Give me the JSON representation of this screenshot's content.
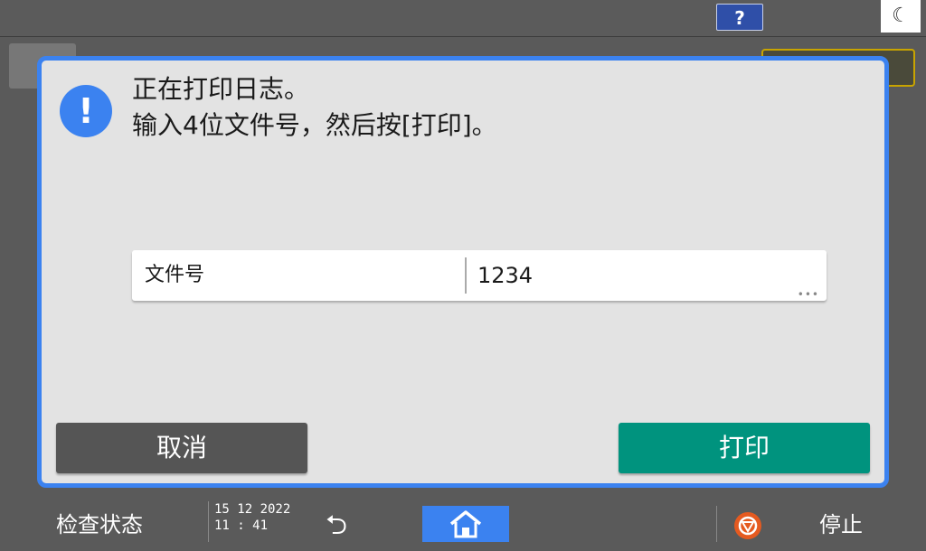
{
  "topbar": {
    "help_label": "?",
    "sleep_icon": "moon-icon"
  },
  "dialog": {
    "message_line1": "正在打印日志。",
    "message_line2": "输入4位文件号，然后按[打印]。",
    "field_label": "文件号",
    "field_value": "1234",
    "cancel_label": "取消",
    "print_label": "打印"
  },
  "bottombar": {
    "status_label": "检查状态",
    "date": "15 12 2022",
    "time": "11 : 41",
    "stop_label": "停止"
  },
  "colors": {
    "accent": "#3b82f0",
    "print_button": "#00937e",
    "cancel_button": "#555555",
    "stop_icon": "#e55a20"
  }
}
